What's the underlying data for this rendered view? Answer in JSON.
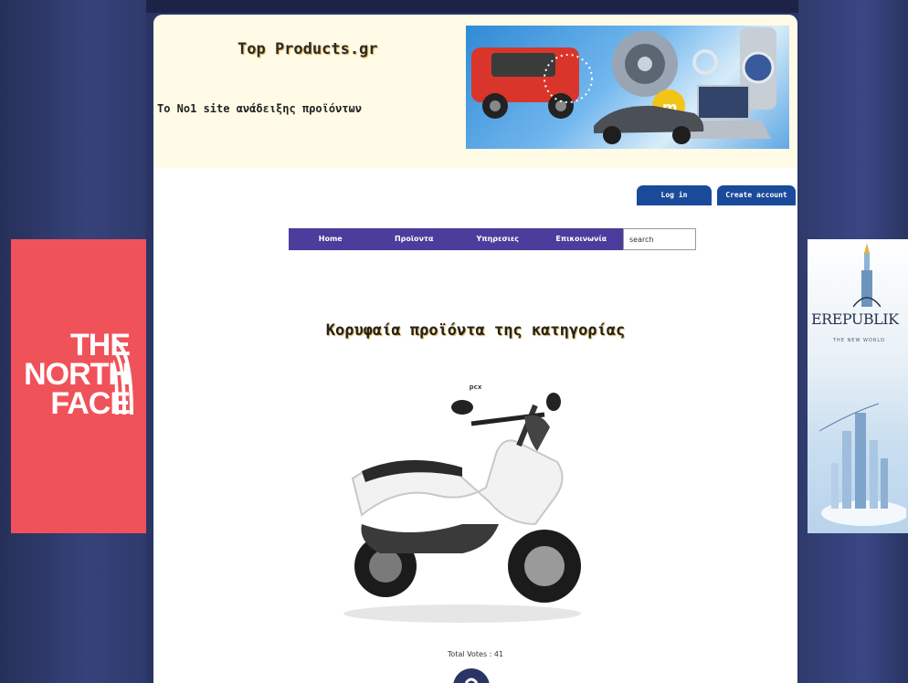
{
  "header": {
    "site_title": "Top Products.gr",
    "tagline": "Το No1 site ανάδειξης προϊόντων"
  },
  "auth": {
    "login_label": "Log in",
    "create_label": "Create account"
  },
  "nav": {
    "items": [
      {
        "label": "Home"
      },
      {
        "label": "Προϊοντα"
      },
      {
        "label": "Υπηρεσιες"
      },
      {
        "label": "Επικοινωνία"
      }
    ],
    "search_value": "search"
  },
  "main": {
    "category_title": "Κορυφαία προϊόντα της κατηγορίας",
    "product_name": "pcx",
    "total_votes": "Total Votes : 41"
  },
  "ads": {
    "left_text": "THE NORTH FACE",
    "right_title": "EREPUBLIK",
    "right_subtitle": "THE NEW WORLD"
  },
  "colors": {
    "background": "#2a3566",
    "nav": "#4b3d9c",
    "auth_button": "#1a4a9a",
    "ad_north": "#f0525a"
  }
}
